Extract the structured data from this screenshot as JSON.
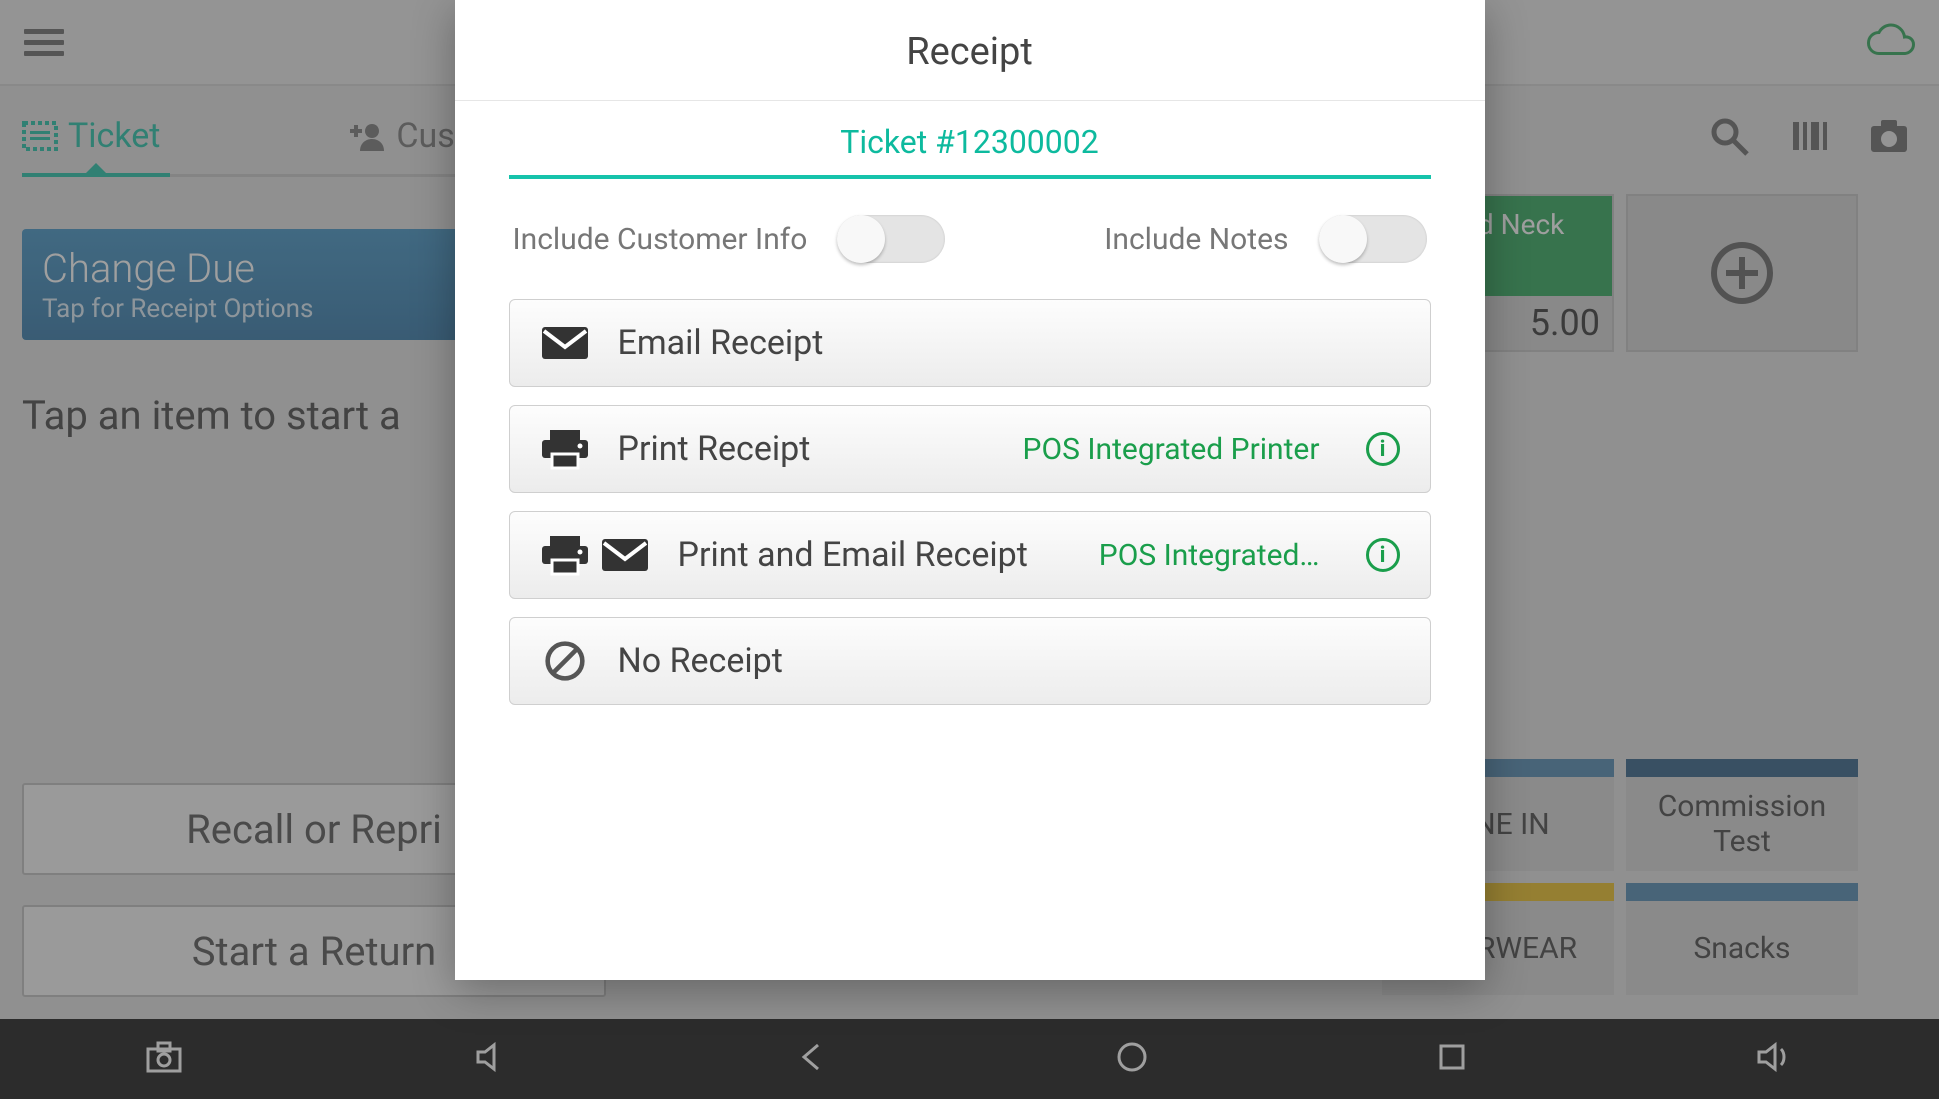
{
  "header": {
    "cloud_status": "online"
  },
  "tabs": {
    "ticket": "Ticket",
    "customer": "Customer"
  },
  "change_due": {
    "title": "Change Due",
    "amount_prefix": "$",
    "sub": "Tap for Receipt Options"
  },
  "hint": "Tap an item to start a",
  "buttons": {
    "recall": "Recall or Repri",
    "return": "Start a Return"
  },
  "product": {
    "name": "pped Neck",
    "price": "5.00"
  },
  "categories": {
    "dinein": "DINE IN",
    "commission": "Commission Test",
    "underwear": "NDERWEAR",
    "snacks": "Snacks"
  },
  "modal": {
    "title": "Receipt",
    "ticket": "Ticket #12300002",
    "toggle1": "Include Customer Info",
    "toggle2": "Include Notes",
    "opt_email": "Email Receipt",
    "opt_print": "Print Receipt",
    "opt_print_printer": "POS Integrated Printer",
    "opt_print_email": "Print and Email Receipt",
    "opt_print_email_printer": "POS Integrated…",
    "opt_none": "No Receipt"
  }
}
